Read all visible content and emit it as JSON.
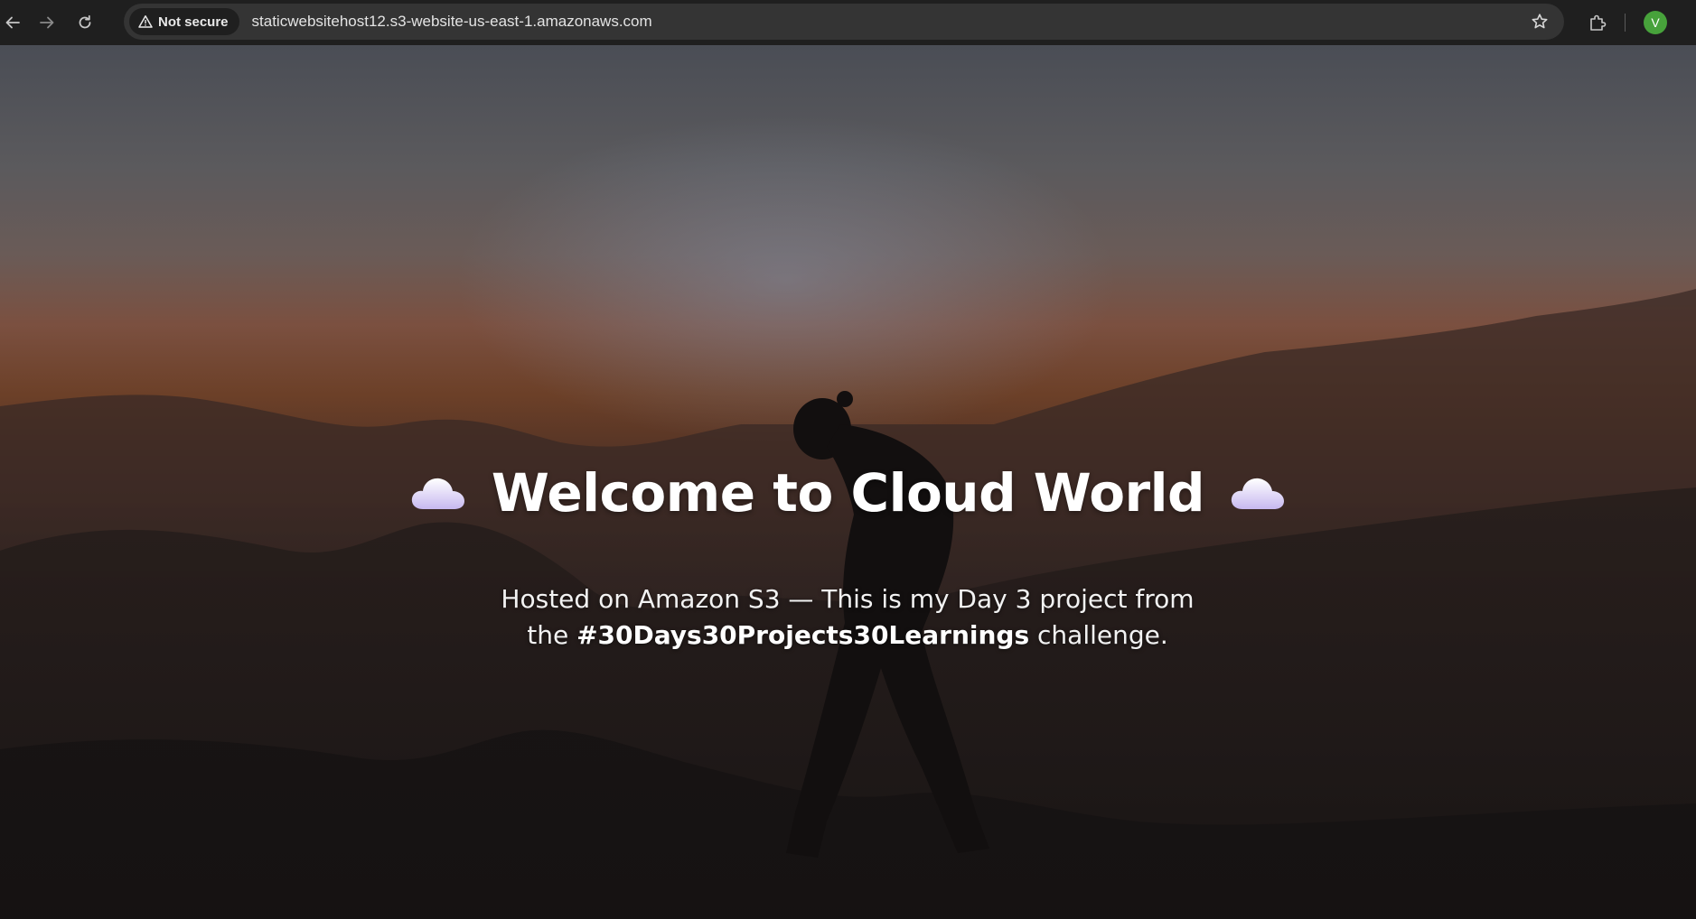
{
  "browser": {
    "security_label": "Not secure",
    "url": "staticwebsitehost12.s3-website-us-east-1.amazonaws.com",
    "profile_initial": "V",
    "icons": {
      "back": "arrow-left-icon",
      "forward": "arrow-right-icon",
      "reload": "reload-icon",
      "warning": "warning-triangle-icon",
      "bookmark": "star-icon",
      "extensions": "puzzle-icon"
    },
    "colors": {
      "toolbar": "#1f1f1f",
      "omnibox": "#343434",
      "avatar": "#47a23b"
    }
  },
  "page": {
    "title": "Welcome to Cloud World",
    "title_icon": "cloud-icon",
    "subtitle_before": "Hosted on Amazon S3 — This is my Day 3 project from the ",
    "subtitle_hashtag": "#30Days30Projects30Learnings",
    "subtitle_after": " challenge."
  }
}
